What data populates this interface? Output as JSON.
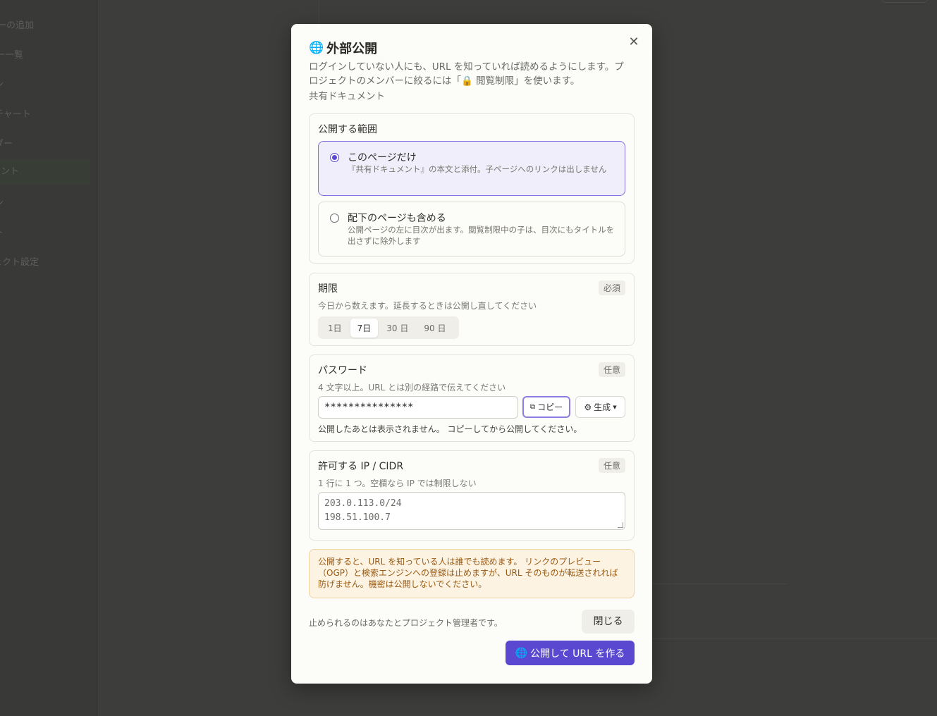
{
  "background": {
    "sidebar_items": [
      "ーの追加",
      "ー一覧",
      "ン",
      "チャート",
      "ダー",
      "メント",
      "ン",
      "ト",
      "ェクト設定"
    ]
  },
  "modal": {
    "title": "外部公開",
    "description_line1": "ログインしていない人にも、URL を知っていれば読めるようにします。プ",
    "description_line2": "ロジェクトのメンバーに絞るには「🔒 閲覧制限」を使います。",
    "subtitle": "共有ドキュメント",
    "close_symbol": "✕",
    "scope": {
      "title": "公開する範囲",
      "options": [
        {
          "label": "このページだけ",
          "description": "『共有ドキュメント』の本文と添付。子ページへのリンクは出しません",
          "selected": true
        },
        {
          "label": "配下のページも含める",
          "description": "公開ページの左に目次が出ます。閲覧制限中の子は、目次にもタイトルを出さずに除外します",
          "selected": false
        }
      ]
    },
    "expiry": {
      "title": "期限",
      "badge": "必須",
      "hint": "今日から数えます。延長するときは公開し直してください",
      "choices": [
        "1日",
        "7日",
        "30 日",
        "90 日"
      ],
      "selected": "7日"
    },
    "password": {
      "title": "パスワード",
      "badge": "任意",
      "hint": "4 文字以上。URL とは別の経路で伝えてください",
      "value": "***************",
      "copy_label": "コピー",
      "generate_label": "生成",
      "note": "公開したあとは表示されません。 コピーしてから公開してください。"
    },
    "ip": {
      "title": "許可する IP / CIDR",
      "badge": "任意",
      "hint": "1 行に 1 つ。空欄なら IP では制限しない",
      "placeholder_lines": [
        "203.0.113.0/24",
        "198.51.100.7"
      ]
    },
    "warning": "公開すると、URL を知っている人は誰でも読めます。 リンクのプレビュー（OGP）と検索エンジンへの登録は止めますが、URL そのものが転送されれば防げません。機密は公開しないでください。",
    "footer_note": "止められるのはあなたとプロジェクト管理者です。",
    "close_button": "閉じる",
    "publish_button": "公開して URL を作る",
    "colors": {
      "accent": "#5a48d0",
      "warning_bg": "#fdf3e3",
      "warning_text": "#9a5a12"
    }
  }
}
